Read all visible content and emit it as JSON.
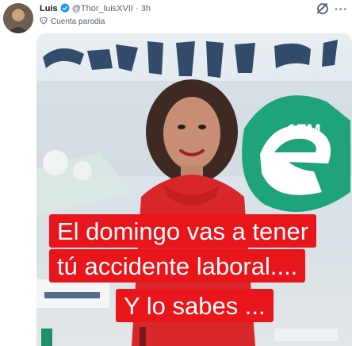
{
  "post": {
    "author_name": "Luis",
    "handle": "@Thor_luisXVII",
    "separator": "·",
    "time": "3h",
    "parody_label": "Cuenta parodia"
  },
  "icons": {
    "avatar": "avatar-image",
    "verified": "verified-badge-icon",
    "parody": "parody-mask-icon",
    "grok": "grok-icon",
    "more": "more-options-icon"
  },
  "media": {
    "background_logo_text": "17M",
    "caption_lines": [
      "El domingo vas a tener",
      "tú accidente laboral....",
      "Y lo sabes ..."
    ]
  },
  "colors": {
    "caption_background": "#e8151b",
    "caption_text": "#ffffff",
    "verified_blue": "#1d9bf0",
    "text_secondary": "#536471"
  }
}
